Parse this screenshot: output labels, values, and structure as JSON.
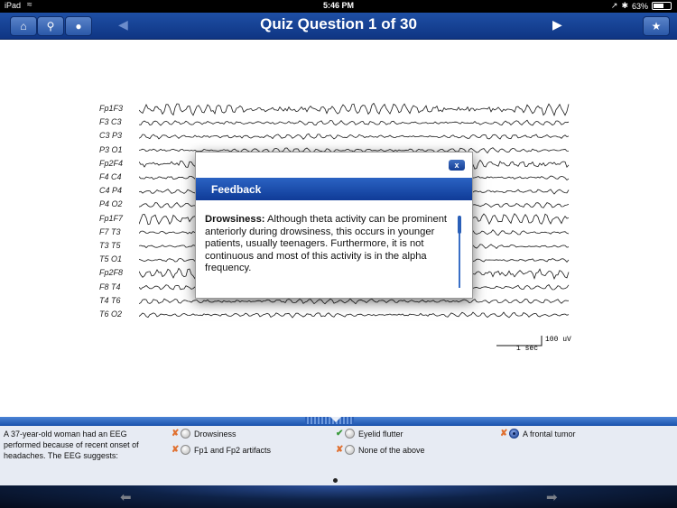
{
  "status": {
    "carrier": "iPad",
    "wifi_icon": "≈",
    "time": "5:46 PM",
    "bluetooth_icon": "✱",
    "battery_percent": "63%",
    "battery_level": 0.63,
    "location_icon": "↗"
  },
  "nav": {
    "title": "Quiz Question 1 of 30",
    "home_icon": "⌂",
    "search_icon": "⚲",
    "info_icon": "●",
    "prev_icon": "◀",
    "next_icon": "▶",
    "star_icon": "★"
  },
  "eeg": {
    "channels": [
      "Fp1F3",
      "F3 C3",
      "C3 P3",
      "P3 O1",
      "Fp2F4",
      "F4 C4",
      "C4 P4",
      "P4 O2",
      "Fp1F7",
      "F7 T3",
      "T3 T5",
      "T5 O1",
      "Fp2F8",
      "F8 T4",
      "T4 T6",
      "T6 O2"
    ],
    "scale_uv": "100 uV",
    "scale_sec": "1 sec"
  },
  "popup": {
    "close_label": "x",
    "header": "Feedback",
    "term": "Drowsiness:",
    "text": " Although theta activity can be prominent anteriorly during drowsiness, this occurs in younger patients, usually teenagers. Furthermore, it is not continuous and most of this activity is in the alpha frequency."
  },
  "quiz": {
    "question": "A 37-year-old woman had an EEG performed because of recent onset of headaches. The EEG suggests:",
    "answers": [
      {
        "label": "Drowsiness",
        "mark": "✘"
      },
      {
        "label": "Fp1 and Fp2 artifacts",
        "mark": "✘"
      },
      {
        "label": "Eyelid flutter",
        "mark": "✔"
      },
      {
        "label": "None of the above",
        "mark": "✘"
      },
      {
        "label": "A frontal tumor",
        "mark": "✘"
      }
    ]
  },
  "bottom": {
    "left_icon": "⬅",
    "right_icon": "➡"
  }
}
